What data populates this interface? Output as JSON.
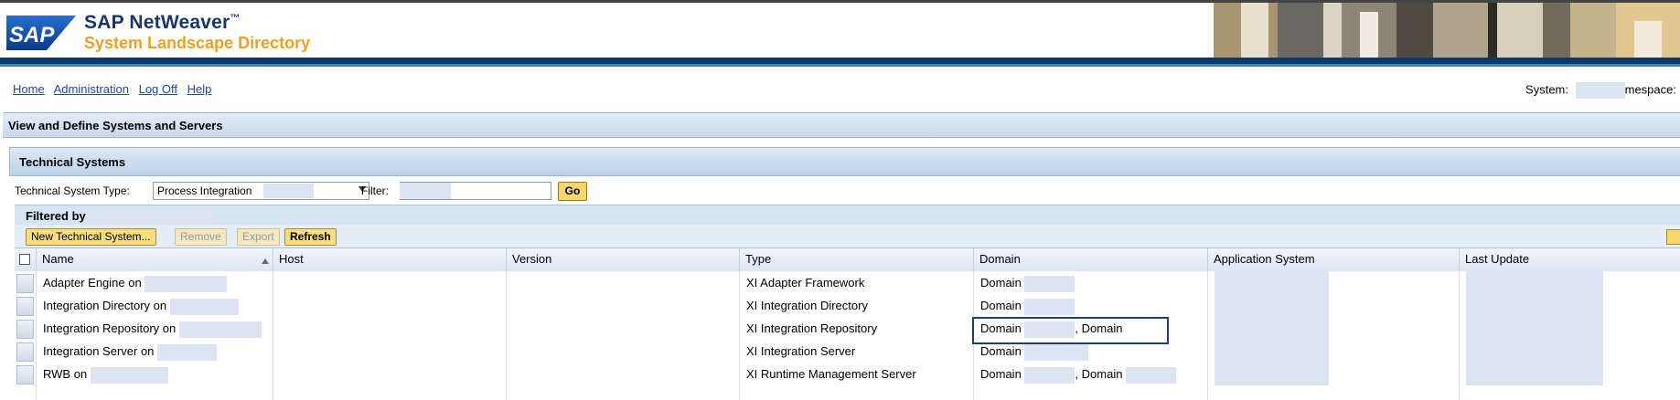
{
  "brand": {
    "logo_text": "SAP",
    "product": "SAP NetWeaver",
    "product_mark": "™",
    "subtitle": "System Landscape Directory"
  },
  "nav": {
    "links": [
      "Home",
      "Administration",
      "Log Off",
      "Help"
    ]
  },
  "sysinfo": {
    "system_label": "System:",
    "namespace_label": "mespace:"
  },
  "page_title": "View and Define Systems and Servers",
  "section_title": "Technical Systems",
  "filter_bar": {
    "type_label": "Technical System Type:",
    "type_value": "Process Integration",
    "filter_label": "Filter:",
    "filter_value": "",
    "go_label": "Go"
  },
  "filtered_by": "Filtered by",
  "toolbar": {
    "new_label": "New Technical System...",
    "remove_label": "Remove",
    "export_label": "Export",
    "refresh_label": "Refresh"
  },
  "table": {
    "columns": [
      "Name",
      "Host",
      "Version",
      "Type",
      "Domain",
      "Application System",
      "Last Update"
    ],
    "rows": [
      {
        "name": "Adapter Engine on",
        "host": "",
        "version": "",
        "type": "XI Adapter Framework",
        "domain": "Domain",
        "domain2": "",
        "app": "",
        "updated": ""
      },
      {
        "name": "Integration Directory on",
        "host": "",
        "version": "",
        "type": "XI Integration Directory",
        "domain": "Domain",
        "domain2": "",
        "app": "",
        "updated": ""
      },
      {
        "name": "Integration Repository on",
        "host": "",
        "version": "",
        "type": "XI Integration Repository",
        "domain": "Domain",
        "domain2": ", Domain",
        "app": "",
        "updated": ""
      },
      {
        "name": "Integration Server on",
        "host": "",
        "version": "",
        "type": "XI Integration Server",
        "domain": "Domain",
        "domain2": "",
        "app": "",
        "updated": ""
      },
      {
        "name": "RWB on",
        "host": "",
        "version": "",
        "type": "XI Runtime Management Server",
        "domain": "Domain",
        "domain2": ", Domain",
        "app": "",
        "updated": ""
      }
    ]
  },
  "colors": {
    "nav_blue": "#1848a8",
    "header_bar": "#0e3a6b",
    "button_yellow": "#f7d66b",
    "highlight_border": "#1f3f7a",
    "redaction": "#dce4f2"
  }
}
